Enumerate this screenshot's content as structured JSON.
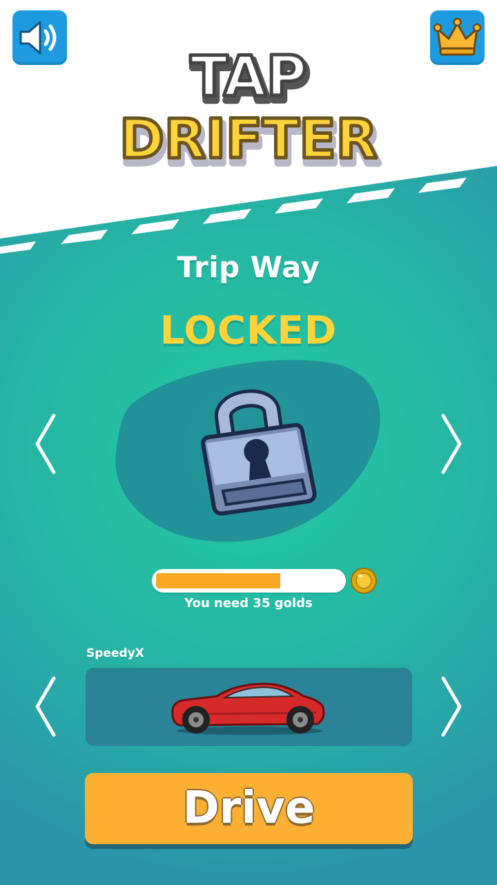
{
  "game": {
    "title_top": "TAP",
    "title_bottom": "DRIFTER"
  },
  "colors": {
    "sky": "#ffffff",
    "ground_center": "#23c8a0",
    "ground_edge": "#2a9aa8",
    "title_top": "#ffffff",
    "title_bottom": "#fdd33a",
    "locked_text": "#fdd33a",
    "button": "#fbb034",
    "icon_button": "#1e9be0"
  },
  "top_bar": {
    "sound_icon": "speaker-on-icon",
    "leaderboard_icon": "crown-icon"
  },
  "track": {
    "name": "Trip Way",
    "status": "LOCKED",
    "preview_icon": "padlock-icon"
  },
  "unlock": {
    "progress_percent": 67,
    "caption": "You need 35 golds",
    "currency_icon": "gold-coin-icon"
  },
  "car": {
    "name": "SpeedyX",
    "color": "#d62a2a"
  },
  "actions": {
    "drive_label": "Drive"
  }
}
